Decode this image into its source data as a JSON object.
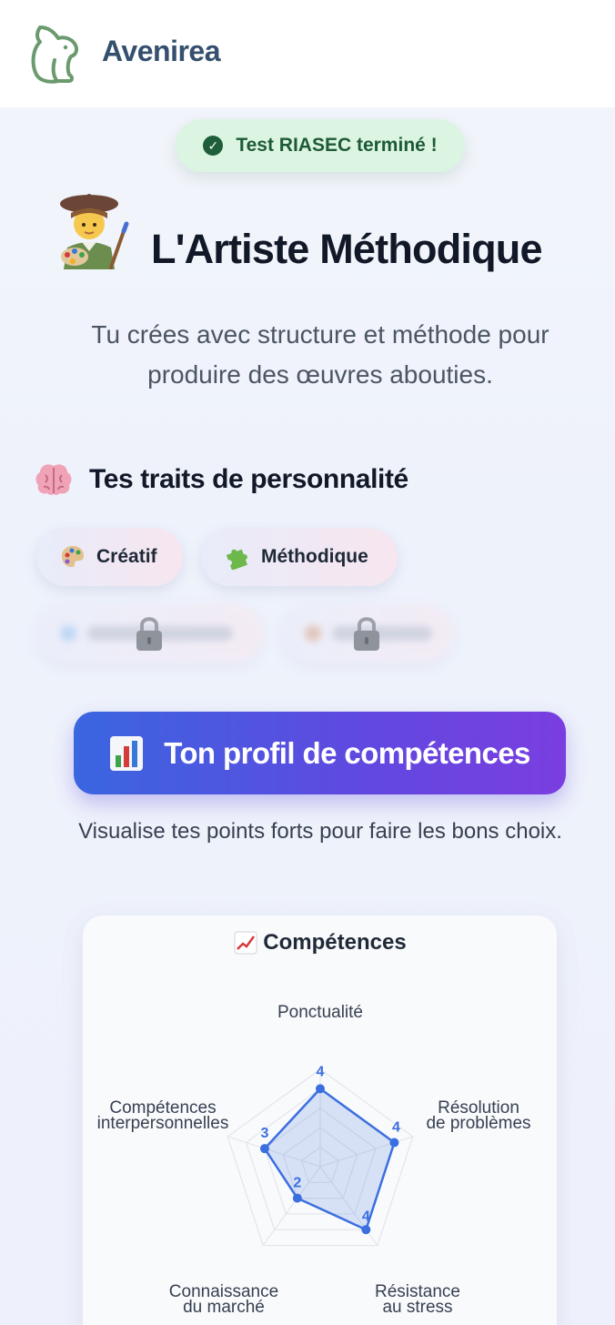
{
  "app": {
    "brand": "Avenirea",
    "logo_icon": "bear-logo-icon",
    "brand_color": "#34506e"
  },
  "status_badge": {
    "label": "Test RIASEC terminé !",
    "icon": "check-circle-icon",
    "bg": "#dcf5e3",
    "color": "#1d5a38"
  },
  "archetype": {
    "emoji": "artist-emoji-icon",
    "title": "L'Artiste Méthodique",
    "description_line1": "Tu crées avec structure et méthode pour",
    "description_line2": "produire des œuvres abouties."
  },
  "traits": {
    "title": "Tes traits de personnalité",
    "icon": "brain-icon",
    "unlocked": [
      {
        "label": "Créatif",
        "icon": "palette-icon"
      },
      {
        "label": "Méthodique",
        "icon": "puzzle-icon"
      }
    ],
    "locked_count": 2,
    "lock_icon": "lock-icon"
  },
  "skills_cta": {
    "icon": "bar-chart-icon",
    "label": "Ton profil de compétences",
    "subtitle": "Visualise tes points forts pour faire les bons choix."
  },
  "skills_card": {
    "title": "Compétences",
    "icon": "chart-increasing-icon"
  },
  "chart_data": {
    "type": "radar",
    "title": "Compétences",
    "axes": [
      [
        "Ponctualité"
      ],
      [
        "Résolution",
        "de problèmes"
      ],
      [
        "Résistance",
        "au stress"
      ],
      [
        "Connaissance",
        "du marché"
      ],
      [
        "Compétences",
        "interpersonnelles"
      ]
    ],
    "values": [
      4,
      4,
      4,
      2,
      3
    ],
    "rmax": 5,
    "rings": 5,
    "color": "#3b6fe0"
  }
}
